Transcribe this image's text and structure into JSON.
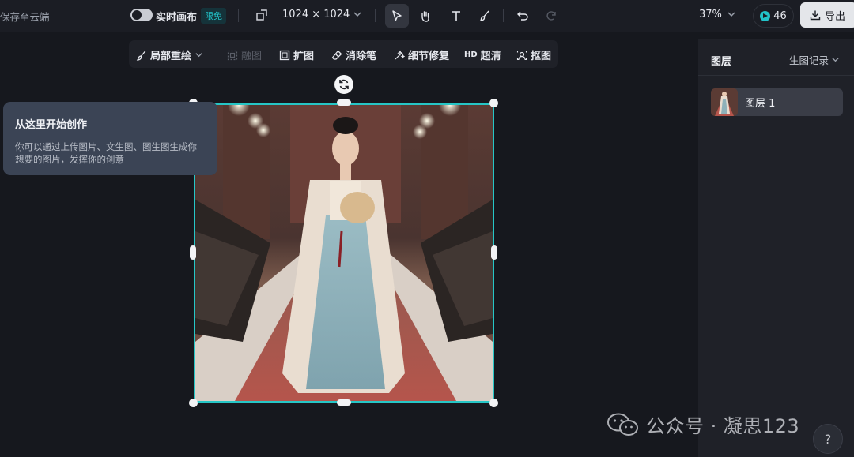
{
  "topbar": {
    "save_cloud": "保存至云端",
    "realtime_canvas_label": "实时画布",
    "realtime_badge": "限免",
    "canvas_size": "1024 × 1024",
    "zoom": "37%",
    "credits": "46",
    "export_label": "导出"
  },
  "edit_toolbar": {
    "items": [
      {
        "label": "局部重绘",
        "icon": "brush-repaint-icon"
      },
      {
        "label": "融图",
        "icon": "blend-icon",
        "disabled": true
      },
      {
        "label": "扩图",
        "icon": "expand-icon"
      },
      {
        "label": "消除笔",
        "icon": "eraser-icon"
      },
      {
        "label": "细节修复",
        "icon": "detail-repair-icon"
      },
      {
        "label": "超清",
        "icon": "hd-icon",
        "prefix": "HD"
      },
      {
        "label": "抠图",
        "icon": "cutout-icon"
      }
    ]
  },
  "tooltip": {
    "title": "从这里开始创作",
    "body": "你可以通过上传图片、文生图、图生图生成你想要的图片，发挥你的创意"
  },
  "right_panel": {
    "title": "图层",
    "history": "生图记录",
    "layers": [
      {
        "name": "图层 1"
      }
    ]
  },
  "watermark": {
    "text": "公众号 · 凝思123"
  },
  "help": {
    "label": "?"
  },
  "colors": {
    "accent": "#26c6c6",
    "background": "#16181e",
    "panel": "#1f2128"
  }
}
